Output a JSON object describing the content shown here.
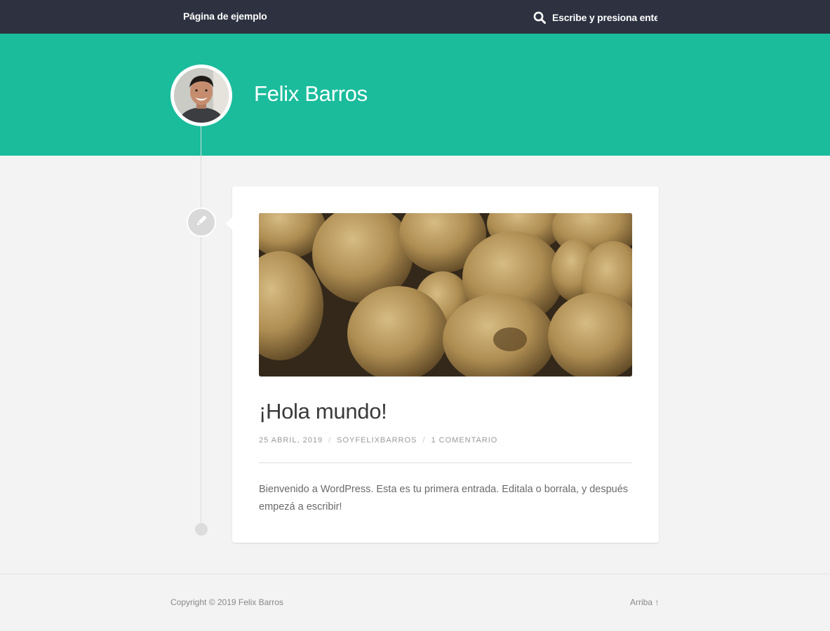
{
  "header": {
    "nav_link": "Página de ejemplo",
    "search_placeholder": "Escribe y presiona ente"
  },
  "hero": {
    "site_title": "Felix Barros"
  },
  "post": {
    "title": "¡Hola mundo!",
    "meta": {
      "date": "25 ABRIL, 2019",
      "author": "SOYFELIXBARROS",
      "comments": "1 COMENTARIO",
      "separator": "/"
    },
    "excerpt": "Bienvenido a WordPress. Esta es tu primera entrada. Editala o borrala, y después empezá a escribir!"
  },
  "footer": {
    "copyright": "Copyright © 2019 Felix Barros",
    "to_top": "Arriba ↑"
  },
  "icons": {
    "search": "search-icon",
    "post_format": "pencil-icon"
  },
  "colors": {
    "topbar": "#2d3140",
    "accent": "#1abc9c",
    "background": "#f3f3f3"
  }
}
